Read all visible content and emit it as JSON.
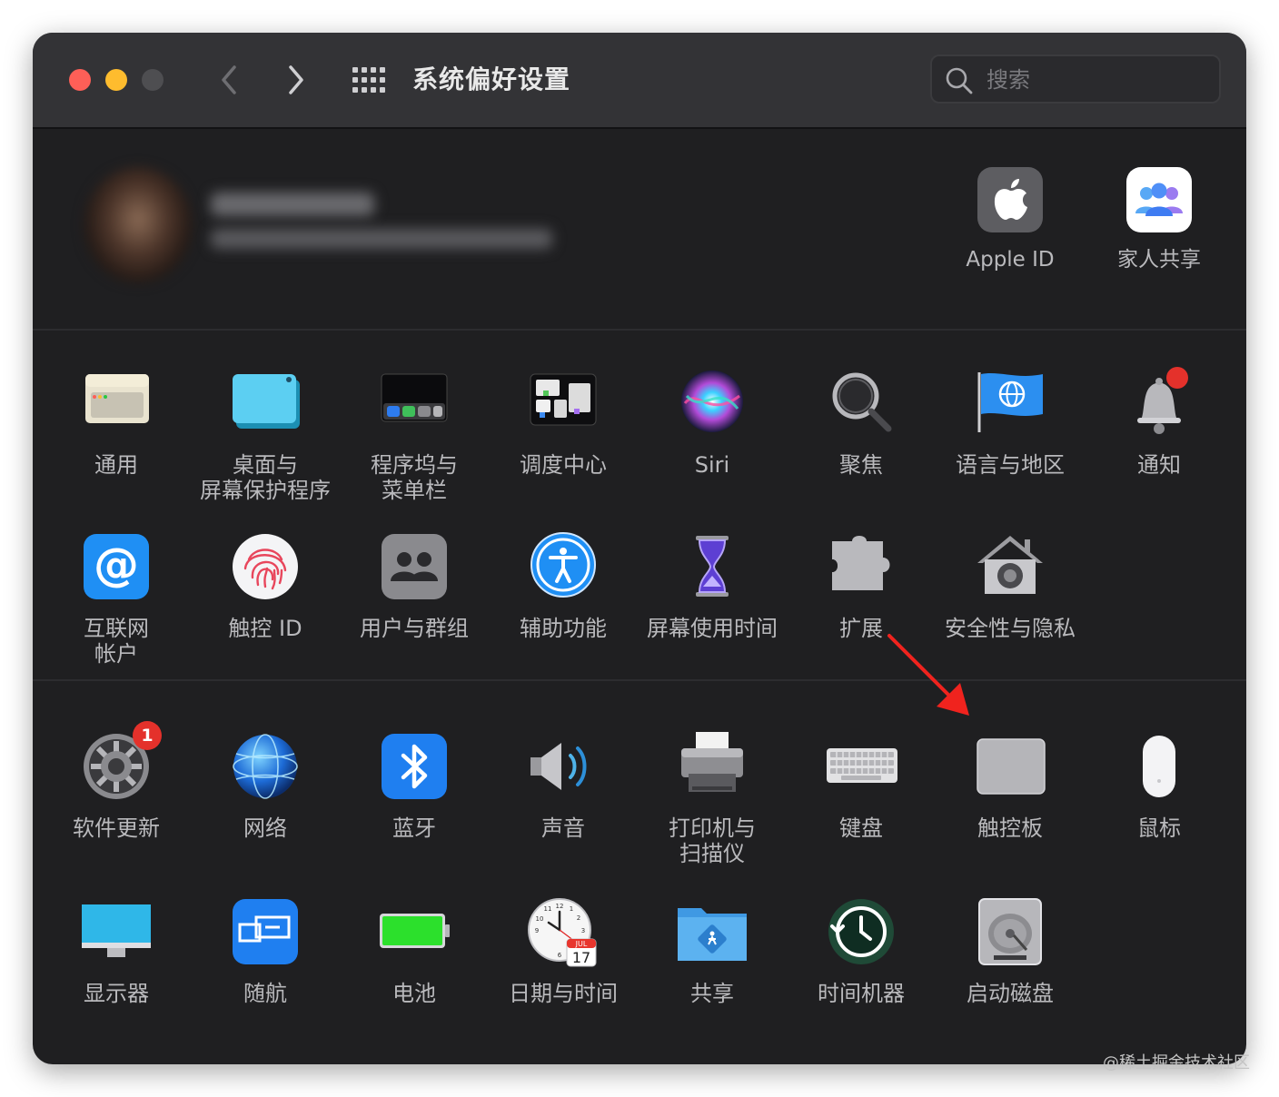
{
  "window": {
    "title": "系统偏好设置"
  },
  "search": {
    "placeholder": "搜索"
  },
  "account": {
    "apple_id_label": "Apple ID",
    "family_label": "家人共享"
  },
  "panes": {
    "general": "通用",
    "desktop": "桌面与\n屏幕保护程序",
    "dock": "程序坞与\n菜单栏",
    "mission": "调度中心",
    "siri": "Siri",
    "spotlight": "聚焦",
    "language": "语言与地区",
    "notifications": "通知",
    "internet": "互联网\n帐户",
    "touchid": "触控 ID",
    "users": "用户与群组",
    "accessibility": "辅助功能",
    "screentime": "屏幕使用时间",
    "extensions": "扩展",
    "security": "安全性与隐私",
    "update": "软件更新",
    "network": "网络",
    "bluetooth": "蓝牙",
    "sound": "声音",
    "printers": "打印机与\n扫描仪",
    "keyboard": "键盘",
    "trackpad": "触控板",
    "mouse": "鼠标",
    "displays": "显示器",
    "sidecar": "随航",
    "battery": "电池",
    "datetime": "日期与时间",
    "sharing": "共享",
    "timemachine": "时间机器",
    "startup": "启动磁盘"
  },
  "badges": {
    "update_count": "1"
  },
  "calendar_icon": {
    "month": "JUL",
    "day": "17"
  },
  "watermark": "@稀土掘金技术社区",
  "colors": {
    "window_bg": "#1f1f21",
    "titlebar_bg": "#333336",
    "label_text": "#b9b9bc",
    "badge_red": "#e4312b",
    "arrow_red": "#f0231e"
  }
}
